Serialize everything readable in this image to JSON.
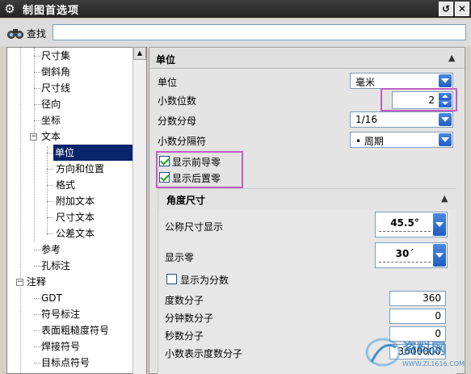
{
  "window": {
    "title": "制图首选项",
    "close_glyph": "✕",
    "reset_glyph": "↺"
  },
  "search": {
    "label": "查找",
    "value": ""
  },
  "tree": {
    "items": [
      {
        "label": "尺寸集"
      },
      {
        "label": "倒斜角"
      },
      {
        "label": "尺寸线"
      },
      {
        "label": "径向"
      },
      {
        "label": "坐标"
      },
      {
        "label": "文本"
      },
      {
        "label": "单位"
      },
      {
        "label": "方向和位置"
      },
      {
        "label": "格式"
      },
      {
        "label": "附加文本"
      },
      {
        "label": "尺寸文本"
      },
      {
        "label": "公差文本"
      },
      {
        "label": "参考"
      },
      {
        "label": "孔标注"
      },
      {
        "label": "注释"
      },
      {
        "label": "GDT"
      },
      {
        "label": "符号标注"
      },
      {
        "label": "表面粗糙度符号"
      },
      {
        "label": "焊接符号"
      },
      {
        "label": "目标点符号"
      }
    ],
    "selected": "单位"
  },
  "units_section": {
    "title": "单位",
    "unit_label": "单位",
    "unit_value": "毫米",
    "decimals_label": "小数位数",
    "decimals_value": "2",
    "denominator_label": "分数分母",
    "denominator_value": "1/16",
    "separator_label": "小数分隔符",
    "separator_value": "• 周期",
    "show_leading_zeros_label": "显示前导零",
    "show_leading_zeros": true,
    "show_trailing_zeros_label": "显示后置零",
    "show_trailing_zeros": true
  },
  "angle_section": {
    "title": "角度尺寸",
    "nominal_label": "公称尺寸显示",
    "nominal_value": "45.5°",
    "zero_label": "显示零",
    "zero_value": "30´",
    "fraction_label": "显示为分数",
    "fraction_checked": false,
    "degree_num_label": "度数分子",
    "degree_num_value": "360",
    "minute_num_label": "分钟数分子",
    "minute_num_value": "0",
    "second_num_label": "秒数分子",
    "second_num_value": "0",
    "decimal_num_label": "小数表示度数分子",
    "decimal_num_value": "3600000"
  },
  "watermark": {
    "text": "资料网",
    "url_text": "WWW.ZL1616.COM"
  },
  "colors": {
    "selection": "#0a246a",
    "highlight": "#c25ec2",
    "accent": "#1f5dc4"
  }
}
